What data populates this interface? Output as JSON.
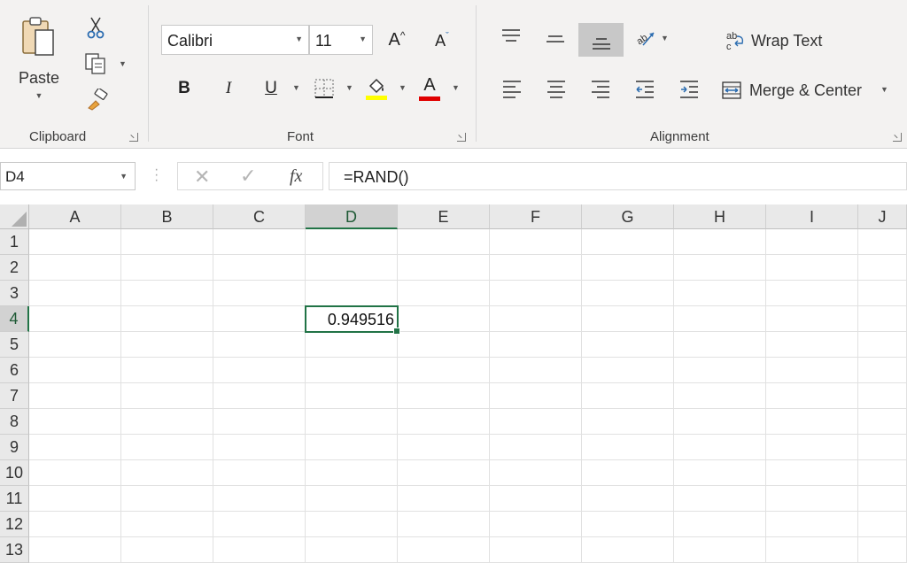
{
  "ribbon": {
    "clipboard": {
      "paste_label": "Paste",
      "group_label": "Clipboard"
    },
    "font": {
      "font_name": "Calibri",
      "font_size": "11",
      "grow_label": "A",
      "shrink_label": "A",
      "bold_label": "B",
      "italic_label": "I",
      "underline_label": "U",
      "font_color_label": "A",
      "group_label": "Font",
      "highlight_color": "#FFFF00",
      "font_color": "#E00000"
    },
    "alignment": {
      "wrap_text_label": "Wrap Text",
      "merge_center_label": "Merge & Center",
      "group_label": "Alignment"
    }
  },
  "formula_bar": {
    "name_box": "D4",
    "fx_label": "fx",
    "formula": "=RAND()"
  },
  "sheet": {
    "columns": [
      "A",
      "B",
      "C",
      "D",
      "E",
      "F",
      "G",
      "H",
      "I",
      "J"
    ],
    "rows": [
      "1",
      "2",
      "3",
      "4",
      "5",
      "6",
      "7",
      "8",
      "9",
      "10",
      "11",
      "12",
      "13"
    ],
    "selected_column": "D",
    "selected_row": "4",
    "active_cell": {
      "ref": "D4",
      "value": "0.949516"
    }
  },
  "colors": {
    "accent": "#217346",
    "ribbon_bg": "#F3F2F1"
  }
}
